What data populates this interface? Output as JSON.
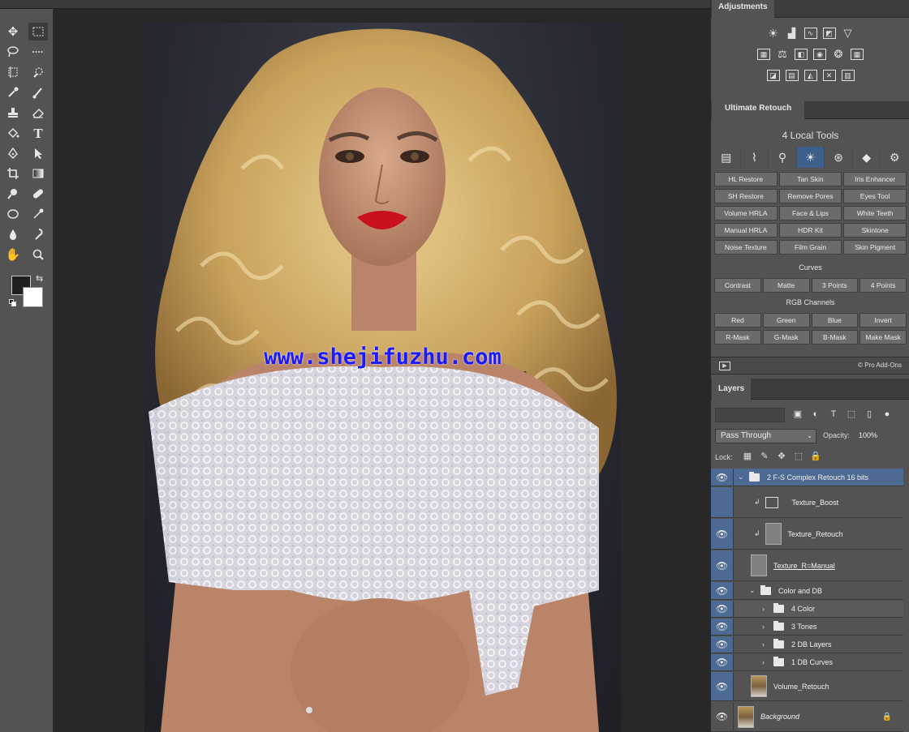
{
  "panels": {
    "adjustments_tab": "Adjustments",
    "ultimate_retouch_tab": "Ultimate Retouch",
    "layers_tab": "Layers"
  },
  "watermark": "www.shejifuzhu.com",
  "ultimate_retouch": {
    "title": "4 Local Tools",
    "tool_buttons": [
      "HL Restore",
      "Tan Skin",
      "Iris Enhancer",
      "SH Restore",
      "Remove Pores",
      "Eyes Tool",
      "Volume HRLA",
      "Face & Lips",
      "White Teeth",
      "Manual HRLA",
      "HDR Kit",
      "Skintone",
      "Noise Texture",
      "Film Grain",
      "Skin Pigment"
    ],
    "curves_label": "Curves",
    "curves_buttons": [
      "Contrast",
      "Matte",
      "3 Points",
      "4 Points"
    ],
    "rgb_label": "RGB Channels",
    "rgb_buttons": [
      "Red",
      "Green",
      "Blue",
      "Invert",
      "R-Mask",
      "G-Mask",
      "B-Mask",
      "Make Mask"
    ],
    "footer": "© Pro Add-Ons"
  },
  "layers_panel": {
    "blend_mode": "Pass Through",
    "opacity_label": "Opacity:",
    "opacity_value": "100%",
    "lock_label": "Lock:",
    "layers": [
      {
        "name": "2 F-S Complex Retouch 16 bits"
      },
      {
        "name": "Texture_Boost"
      },
      {
        "name": "Texture_Retouch"
      },
      {
        "name": "Texture_R=Manual"
      },
      {
        "name": "Color and DB"
      },
      {
        "name": "4 Color"
      },
      {
        "name": "3 Tones"
      },
      {
        "name": "2 DB Layers"
      },
      {
        "name": "1 DB Curves"
      },
      {
        "name": "Volume_Retouch"
      },
      {
        "name": "Background"
      }
    ]
  },
  "colors": {
    "accent_selection": "#4d6a93",
    "panel_bg": "#535353",
    "watermark": "#1a1aff"
  }
}
